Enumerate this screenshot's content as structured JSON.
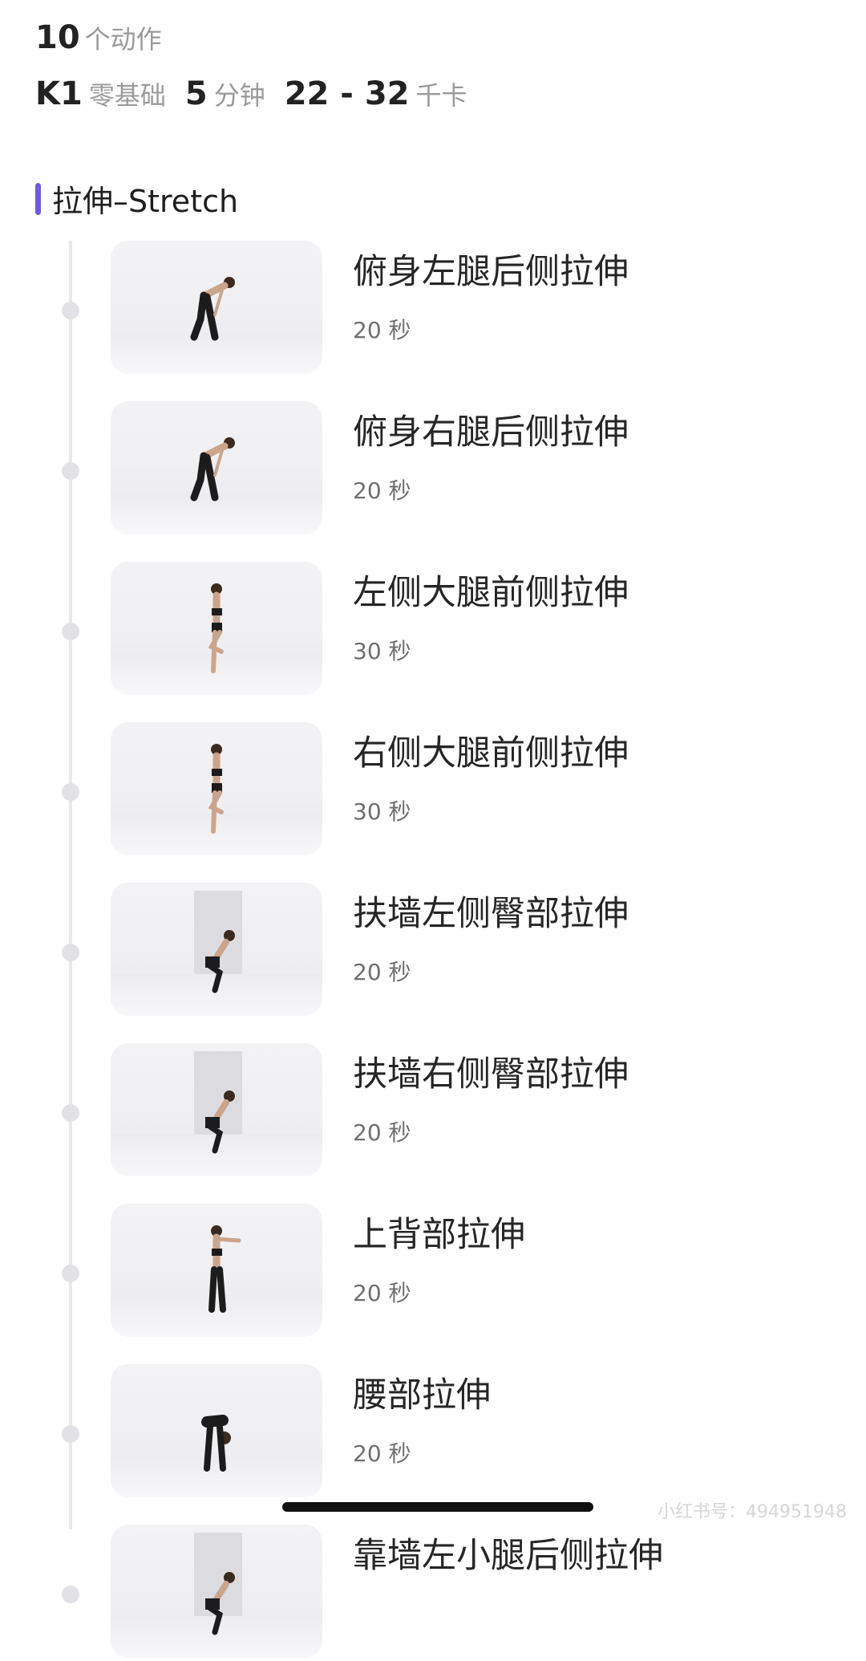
{
  "summary": {
    "count_value": "10",
    "count_unit": "个动作",
    "level_value": "K1",
    "level_unit": "零基础",
    "minutes_value": "5",
    "minutes_unit": "分钟",
    "calories_value": "22 - 32",
    "calories_unit": "千卡"
  },
  "section": {
    "title": "拉伸–Stretch",
    "accent_color": "#6e5ae6"
  },
  "exercises": [
    {
      "name": "俯身左腿后侧拉伸",
      "duration": "20 秒"
    },
    {
      "name": "俯身右腿后侧拉伸",
      "duration": "20 秒"
    },
    {
      "name": "左侧大腿前侧拉伸",
      "duration": "30 秒"
    },
    {
      "name": "右侧大腿前侧拉伸",
      "duration": "30 秒"
    },
    {
      "name": "扶墙左侧臀部拉伸",
      "duration": "20 秒"
    },
    {
      "name": "扶墙右侧臀部拉伸",
      "duration": "20 秒"
    },
    {
      "name": "上背部拉伸",
      "duration": "20 秒"
    },
    {
      "name": "腰部拉伸",
      "duration": "20 秒"
    },
    {
      "name": "靠墙左小腿后侧拉伸",
      "duration": ""
    }
  ],
  "watermark": "小红书号：494951948"
}
